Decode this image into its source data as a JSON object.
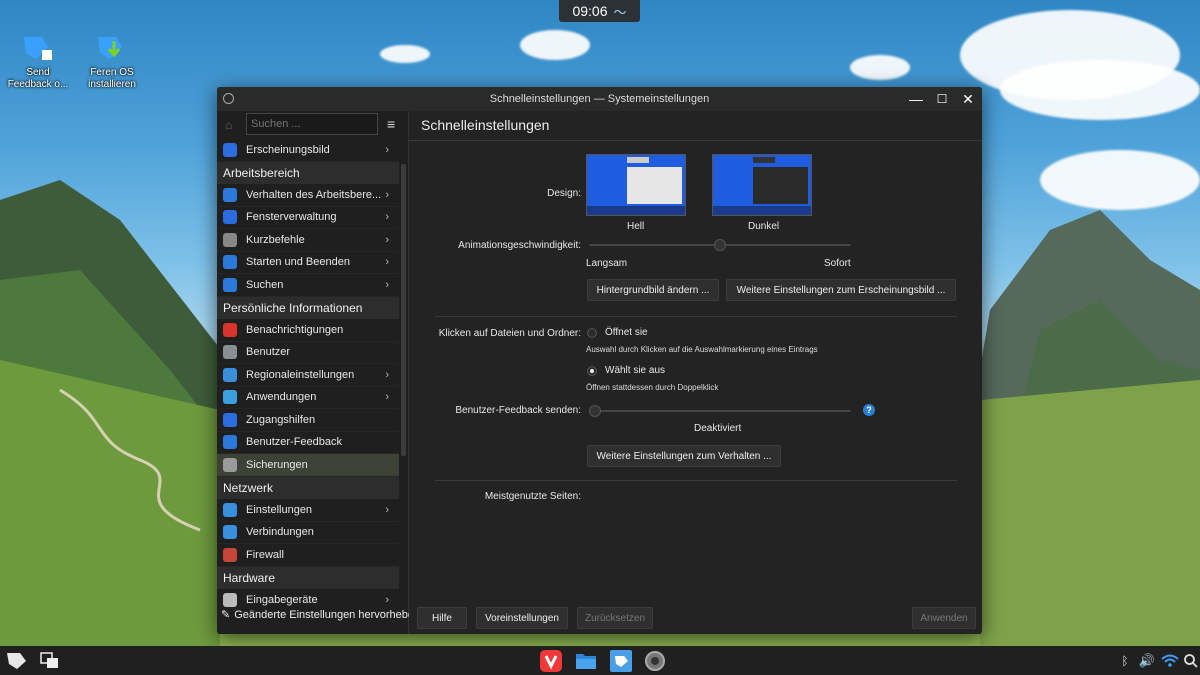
{
  "top_clock": {
    "time": "09:06",
    "icon": "weather-wave-icon"
  },
  "desktop_icons": [
    {
      "label": "Send Feedback o...",
      "icon": "send-feedback-icon"
    },
    {
      "label": "Feren OS installieren",
      "icon": "install-os-icon"
    }
  ],
  "window": {
    "title": "Schnelleinstellungen — Systemeinstellungen",
    "controls": {
      "minimize": "—",
      "maximize": "☐",
      "close": "✕"
    }
  },
  "sidebar": {
    "search_placeholder": "Suchen ...",
    "items": [
      {
        "type": "item",
        "label": "Erscheinungsbild",
        "icon_color": "#2b6de0",
        "chevron": true
      },
      {
        "type": "header",
        "label": "Arbeitsbereich"
      },
      {
        "type": "item",
        "label": "Verhalten des Arbeitsbere...",
        "icon_color": "#2b79d8",
        "chevron": true
      },
      {
        "type": "item",
        "label": "Fensterverwaltung",
        "icon_color": "#2b6de0",
        "chevron": true
      },
      {
        "type": "item",
        "label": "Kurzbefehle",
        "icon_color": "#888888",
        "chevron": true
      },
      {
        "type": "item",
        "label": "Starten und Beenden",
        "icon_color": "#2b79d8",
        "chevron": true
      },
      {
        "type": "item",
        "label": "Suchen",
        "icon_color": "#2b79d8",
        "chevron": true
      },
      {
        "type": "header",
        "label": "Persönliche Informationen"
      },
      {
        "type": "item",
        "label": "Benachrichtigungen",
        "icon_color": "#d9342b",
        "chevron": false
      },
      {
        "type": "item",
        "label": "Benutzer",
        "icon_color": "#8a8f95",
        "chevron": false
      },
      {
        "type": "item",
        "label": "Regionaleinstellungen",
        "icon_color": "#3a8fdc",
        "chevron": true
      },
      {
        "type": "item",
        "label": "Anwendungen",
        "icon_color": "#3aa0e0",
        "chevron": true
      },
      {
        "type": "item",
        "label": "Zugangshilfen",
        "icon_color": "#2b6de0",
        "chevron": false
      },
      {
        "type": "item",
        "label": "Benutzer-Feedback",
        "icon_color": "#2b79d8",
        "chevron": false
      },
      {
        "type": "item",
        "label": "Sicherungen",
        "icon_color": "#9a9a9a",
        "chevron": false,
        "selected": true
      },
      {
        "type": "header",
        "label": "Netzwerk"
      },
      {
        "type": "item",
        "label": "Einstellungen",
        "icon_color": "#3a8fdc",
        "chevron": true
      },
      {
        "type": "item",
        "label": "Verbindungen",
        "icon_color": "#3a8fdc",
        "chevron": false
      },
      {
        "type": "item",
        "label": "Firewall",
        "icon_color": "#c4473a",
        "chevron": false
      },
      {
        "type": "header",
        "label": "Hardware"
      },
      {
        "type": "item",
        "label": "Eingabegeräte",
        "icon_color": "#bbbbbb",
        "chevron": true
      }
    ],
    "highlight_changed": "Geänderte Einstellungen hervorheben"
  },
  "content": {
    "title": "Schnelleinstellungen",
    "design_label": "Design:",
    "themes": [
      {
        "label": "Hell"
      },
      {
        "label": "Dunkel"
      }
    ],
    "animation_label": "Animationsgeschwindigkeit:",
    "animation_min": "Langsam",
    "animation_max": "Sofort",
    "animation_value": 0.5,
    "wallpaper_button": "Hintergrundbild ändern ...",
    "appearance_more_button": "Weitere Einstellungen zum Erscheinungsbild ...",
    "click_label": "Klicken auf Dateien und Ordner:",
    "click_option1": "Öffnet sie",
    "click_option1_desc": "Auswahl durch Klicken auf die Auswahlmarkierung eines Eintrags",
    "click_option2": "Wählt sie aus",
    "click_option2_desc": "Öffnen stattdessen durch Doppelklick",
    "feedback_label": "Benutzer-Feedback senden:",
    "feedback_value_text": "Deaktiviert",
    "feedback_value": 0,
    "behavior_more_button": "Weitere Einstellungen zum Verhalten ...",
    "most_used_label": "Meistgenutzte Seiten:"
  },
  "footer": {
    "help": "Hilfe",
    "defaults": "Voreinstellungen",
    "reset": "Zurücksetzen",
    "apply": "Anwenden"
  },
  "taskbar": {
    "pinned": [
      "vivaldi-icon",
      "file-manager-icon",
      "store-icon",
      "settings-icon"
    ],
    "tray": [
      "bluetooth-icon",
      "volume-icon",
      "wifi-icon",
      "search-icon"
    ]
  }
}
